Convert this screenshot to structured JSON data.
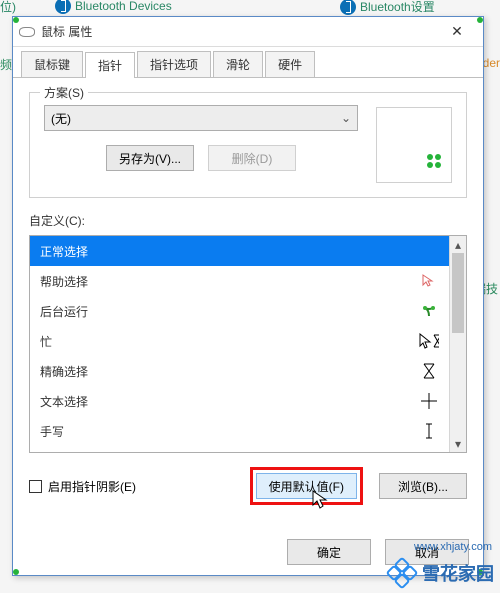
{
  "bg": {
    "left_partial": "位)",
    "right_edge_1": "频",
    "right_edge_2": "端技",
    "bt1": "Bluetooth Devices",
    "bt2": "Bluetooth设置",
    "folder_partial": "der"
  },
  "dialog": {
    "title": "鼠标 属性",
    "close_glyph": "✕",
    "tabs": [
      "鼠标键",
      "指针",
      "指针选项",
      "滑轮",
      "硬件"
    ],
    "active_tab_index": 1,
    "scheme": {
      "label": "方案(S)",
      "value": "(无)",
      "save_as": "另存为(V)...",
      "delete": "删除(D)"
    },
    "customize_label": "自定义(C):",
    "cursors": [
      {
        "name": "正常选择",
        "icon": "clover"
      },
      {
        "name": "帮助选择",
        "icon": "help-arrow"
      },
      {
        "name": "后台运行",
        "icon": "sprout"
      },
      {
        "name": "忙",
        "icon": "arrow-hourglass"
      },
      {
        "name": "精确选择",
        "icon": "hourglass"
      },
      {
        "name": "文本选择",
        "icon": "crosshair"
      },
      {
        "name": "手写",
        "icon": "ibeam"
      },
      {
        "name_extra": "",
        "icon": "pen"
      }
    ],
    "selected_cursor_index": 0,
    "shadow_checkbox": "启用指针阴影(E)",
    "use_default": "使用默认值(F)",
    "browse": "浏览(B)...",
    "ok": "确定",
    "cancel": "取消"
  },
  "watermark": {
    "text": "雪花家园",
    "domain": "www.xhjaty.com"
  }
}
